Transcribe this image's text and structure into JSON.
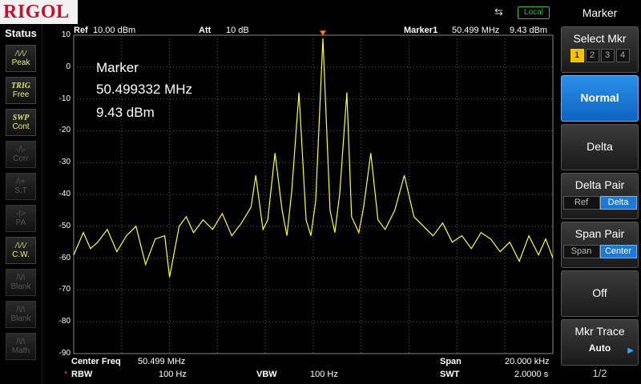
{
  "topbar": {
    "brand": "RIGOL",
    "local_label": "Local"
  },
  "status": {
    "title": "Status",
    "items": [
      {
        "name": "peak",
        "icon": "/\\/\\/",
        "label": "Peak",
        "active": true
      },
      {
        "name": "trig",
        "icon": "TRIG",
        "label": "Free",
        "active": true
      },
      {
        "name": "swp",
        "icon": "SWP",
        "label": "Cont",
        "active": true
      },
      {
        "name": "corr",
        "icon": "-/\\-",
        "label": "Corr",
        "active": false
      },
      {
        "name": "st",
        "icon": "/\\+",
        "label": "S.T",
        "active": false
      },
      {
        "name": "pa",
        "icon": "-|>",
        "label": "PA",
        "active": false
      },
      {
        "name": "cw",
        "icon": "/\\/\\/",
        "label": "C.W.",
        "active": true
      },
      {
        "name": "blank1",
        "icon": "/\\/\\",
        "label": "Blank",
        "active": false
      },
      {
        "name": "blank2",
        "icon": "/\\/\\",
        "label": "Blank",
        "active": false
      },
      {
        "name": "math",
        "icon": "/\\/\\",
        "label": "Math",
        "active": false
      }
    ]
  },
  "header": {
    "ref_label": "Ref",
    "ref_value": "10.00 dBm",
    "att_label": "Att",
    "att_value": "10 dB",
    "marker_label": "Marker1",
    "marker_freq": "50.499 MHz",
    "marker_amp": "9.43 dBm"
  },
  "marker_readout": {
    "title": "Marker",
    "freq": "50.499332 MHz",
    "amp": "9.43 dBm"
  },
  "footer": {
    "center_label": "Center Freq",
    "center_value": "50.499 MHz",
    "span_label": "Span",
    "span_value": "20.000 kHz",
    "rbw_star": "*",
    "rbw_label": "RBW",
    "rbw_value": "100 Hz",
    "vbw_label": "VBW",
    "vbw_value": "100 Hz",
    "swt_label": "SWT",
    "swt_value": "2.0000 s"
  },
  "menu": {
    "title": "Marker",
    "select_mkr": {
      "label": "Select Mkr",
      "options": [
        "1",
        "2",
        "3",
        "4"
      ],
      "selected": "1"
    },
    "normal": "Normal",
    "delta": "Delta",
    "delta_pair": {
      "label": "Delta Pair",
      "options": [
        "Ref",
        "Delta"
      ],
      "selected": "Delta"
    },
    "span_pair": {
      "label": "Span Pair",
      "options": [
        "Span",
        "Center"
      ],
      "selected": "Center"
    },
    "off": "Off",
    "mkr_trace": {
      "label": "Mkr Trace",
      "value": "Auto"
    },
    "page": "1/2"
  },
  "colors": {
    "trace": "#ffff33",
    "grid": "#5a5a5a",
    "active": "#1f78d1",
    "marker_sel": "#f5c400"
  },
  "chart_data": {
    "type": "line",
    "y_ticks": [
      "10",
      "0",
      "-10",
      "-20",
      "-30",
      "-40",
      "-50",
      "-60",
      "-70",
      "-80",
      "-90"
    ],
    "ylim": [
      -90,
      10
    ],
    "xlim": [
      0,
      10
    ],
    "grid": true,
    "series": [
      {
        "x": [
          0.0,
          0.2,
          0.35,
          0.5,
          0.7,
          0.9,
          1.1,
          1.3,
          1.5,
          1.7,
          1.9,
          2.0,
          2.2,
          2.35,
          2.5,
          2.7,
          2.9,
          3.1,
          3.3,
          3.5,
          3.7,
          3.8,
          3.95,
          4.05,
          4.2,
          4.35,
          4.45,
          4.55,
          4.7,
          4.85,
          4.95,
          5.05,
          5.2,
          5.35,
          5.45,
          5.55,
          5.7,
          5.8,
          5.95,
          6.05,
          6.2,
          6.35,
          6.5,
          6.7,
          6.9,
          7.1,
          7.3,
          7.5,
          7.7,
          7.9,
          8.1,
          8.3,
          8.5,
          8.7,
          8.9,
          9.1,
          9.3,
          9.5,
          9.7,
          9.85,
          10.0
        ],
        "y": [
          -59,
          -52,
          -57,
          -55,
          -51,
          -58,
          -53,
          -50,
          -62,
          -54,
          -53,
          -66,
          -50,
          -47,
          -52,
          -48,
          -51,
          -46,
          -53,
          -49,
          -44,
          -34,
          -51,
          -48,
          -27,
          -45,
          -53,
          -39,
          -8,
          -48,
          -53,
          -42,
          9,
          -45,
          -52,
          -40,
          -8,
          -47,
          -52,
          -44,
          -27,
          -48,
          -51,
          -45,
          -34,
          -47,
          -50,
          -53,
          -49,
          -55,
          -53,
          -57,
          -52,
          -54,
          -58,
          -55,
          -61,
          -53,
          -59,
          -54,
          -60
        ]
      }
    ],
    "marker": {
      "x": 5.2,
      "y": 9.43,
      "label": "1"
    }
  }
}
